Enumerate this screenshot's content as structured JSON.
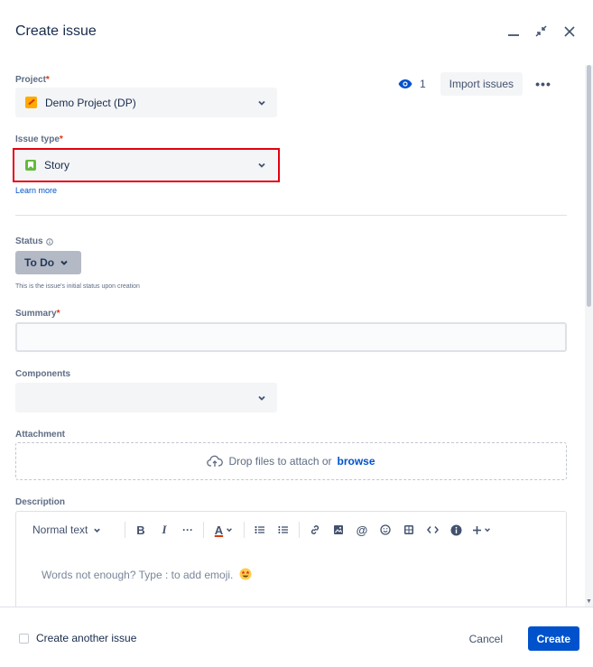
{
  "header": {
    "title": "Create issue"
  },
  "top_actions": {
    "watch_count": "1",
    "import_label": "Import issues",
    "more_label": "•••"
  },
  "project": {
    "label": "Project",
    "required_mark": "*",
    "value": "Demo Project (DP)"
  },
  "issue_type": {
    "label": "Issue type",
    "required_mark": "*",
    "value": "Story",
    "learn_more": "Learn more"
  },
  "status": {
    "label": "Status",
    "value": "To Do",
    "help": "This is the issue's initial status upon creation"
  },
  "summary": {
    "label": "Summary",
    "required_mark": "*",
    "value": ""
  },
  "components": {
    "label": "Components",
    "value": ""
  },
  "attachment": {
    "label": "Attachment",
    "drop_text": "Drop files to attach or",
    "browse": "browse"
  },
  "description": {
    "label": "Description",
    "toolbar": {
      "text_style": "Normal text",
      "bold": "B",
      "italic": "I",
      "more": "···",
      "color": "A"
    },
    "placeholder": "Words not enough? Type : to add emoji."
  },
  "footer": {
    "create_another": "Create another issue",
    "cancel": "Cancel",
    "create": "Create"
  },
  "colors": {
    "primary": "#0052cc",
    "highlight": "#e3000f",
    "story": "#63ba3c",
    "project": "#ffab00"
  }
}
